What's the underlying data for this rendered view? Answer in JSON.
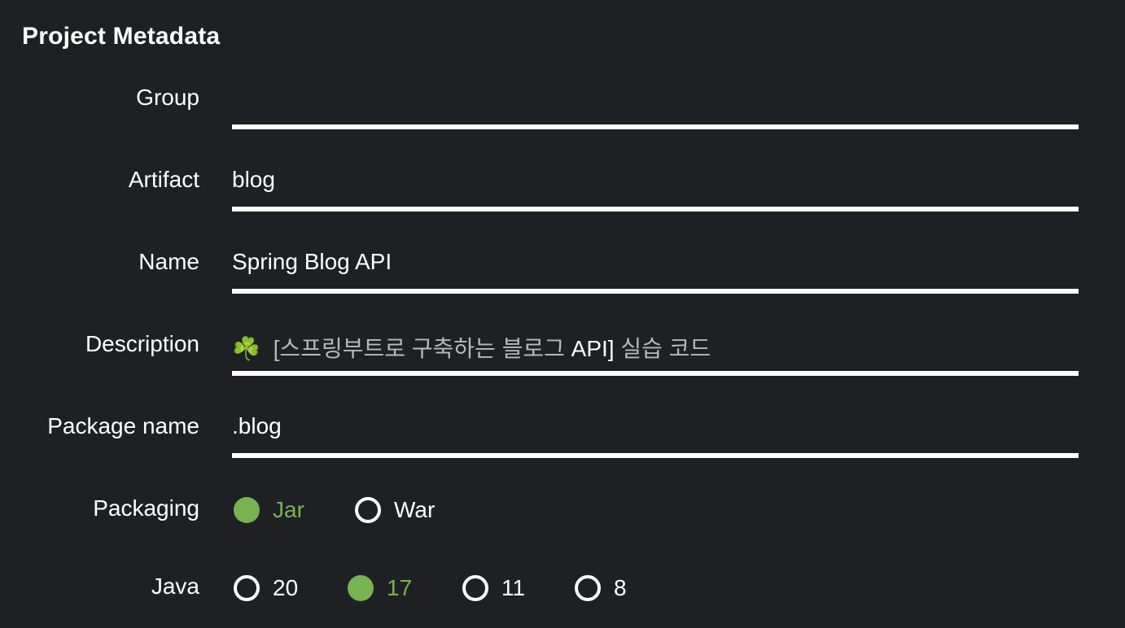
{
  "title": "Project Metadata",
  "fields": {
    "group": {
      "label": "Group",
      "value": ""
    },
    "artifact": {
      "label": "Artifact",
      "value": "blog"
    },
    "name": {
      "label": "Name",
      "value": "Spring Blog API"
    },
    "description": {
      "label": "Description",
      "icon": "shamrock-icon",
      "icon_glyph": "☘️",
      "value_prefix": " [스프링부트로 구축하는 블로그 ",
      "value_strong": "API]",
      "value_suffix": " 실습 코드"
    },
    "package_name": {
      "label": "Package name",
      "value": ".blog"
    }
  },
  "packaging": {
    "label": "Packaging",
    "options": [
      "Jar",
      "War"
    ],
    "selected": "Jar"
  },
  "java": {
    "label": "Java",
    "options": [
      "20",
      "17",
      "11",
      "8"
    ],
    "selected": "17"
  },
  "colors": {
    "background": "#1e2024",
    "accent": "#77b350",
    "text": "#ffffff"
  }
}
